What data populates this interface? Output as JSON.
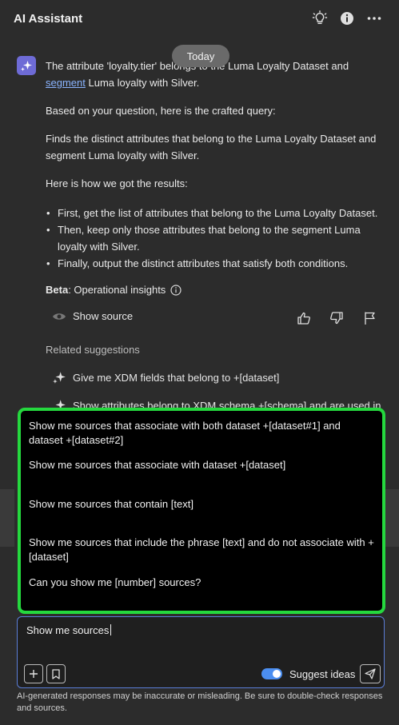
{
  "header": {
    "title": "AI Assistant",
    "icons": [
      "lightbulb-icon",
      "info-icon",
      "more-icon"
    ]
  },
  "today_badge": "Today",
  "message": {
    "line1_before": "The attribute 'loyalty.tier' belongs to the Luma Loyalty Dataset and",
    "link": "segment",
    "line1_after": " Luma loyalty with Silver.",
    "p2": "Based on your question, here is the crafted query:",
    "p3": "Finds the distinct attributes that belong to the Luma Loyalty Dataset and segment Luma loyalty with Silver.",
    "p4": "Here is how we got the results:",
    "bullets": [
      "First, get the list of attributes that belong to the Luma Loyalty Dataset.",
      "Then, keep only those attributes that belong to the segment Luma loyalty with Silver.",
      "Finally, output the distinct attributes that satisfy both conditions."
    ]
  },
  "beta": {
    "bold": "Beta",
    "rest": ": Operational insights"
  },
  "show_source": "Show source",
  "related": {
    "heading": "Related suggestions",
    "items": [
      "Give me XDM fields that belong to +[dataset]",
      "Show attributes belong to XDM schema +[schema] and are used in"
    ]
  },
  "suggestions": [
    "Show me sources that associate with both dataset +[dataset#1] and dataset +[dataset#2]",
    "Show me sources that associate with dataset +[dataset]",
    "Show me sources that contain [text]",
    "Show me sources that include the phrase [text] and do not associate with +[dataset]",
    "Can you show me [number] sources?"
  ],
  "input": {
    "value": "Show me sources"
  },
  "toggle": {
    "label": "Suggest ideas",
    "on": true
  },
  "disclaimer": "AI-generated responses may be inaccurate or misleading. Be sure to double-check responses and sources.",
  "colors": {
    "background": "#2c2c2c",
    "highlight_border": "#25d83e",
    "toggle": "#4b8ef0",
    "link": "#8ab4ff",
    "avatar": "#6e6bd6"
  }
}
